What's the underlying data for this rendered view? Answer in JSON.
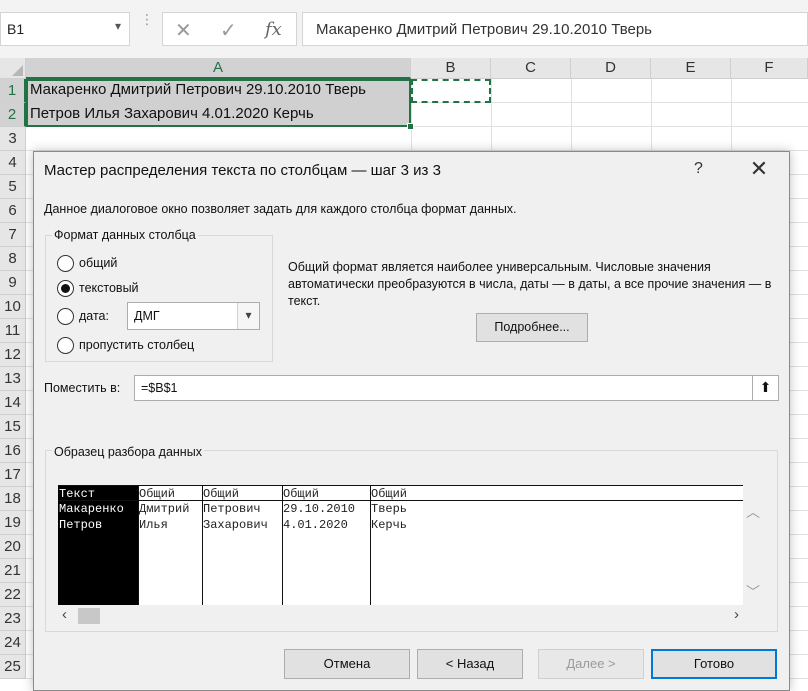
{
  "formula_bar": {
    "name_box": "B1",
    "name_box_arrow": "▾",
    "dots": "⋮",
    "cancel_glyph": "✕",
    "enter_glyph": "✓",
    "fx_glyph": "fx",
    "formula": "Макаренко Дмитрий Петрович 29.10.2010 Тверь"
  },
  "grid": {
    "columns": [
      "A",
      "B",
      "C",
      "D",
      "E",
      "F"
    ],
    "rows": [
      "1",
      "2",
      "3",
      "4",
      "5",
      "6",
      "7",
      "8",
      "9",
      "10",
      "11",
      "12",
      "13",
      "14",
      "15",
      "16",
      "17",
      "18",
      "19",
      "20",
      "21",
      "22",
      "23",
      "24",
      "25"
    ],
    "cells": {
      "A1": "Макаренко Дмитрий Петрович 29.10.2010 Тверь",
      "A2": "Петров Илья Захарович 4.01.2020 Керчь"
    }
  },
  "dialog": {
    "title": "Мастер распределения текста по столбцам — шаг 3 из 3",
    "help": "?",
    "close": "✕",
    "description": "Данное диалоговое окно позволяет задать для каждого столбца формат данных.",
    "format_group": {
      "label": "Формат данных столбца",
      "options": [
        {
          "label": "общий",
          "checked": false
        },
        {
          "label": "текстовый",
          "checked": true
        },
        {
          "label": "дата:",
          "checked": false
        },
        {
          "label": "пропустить столбец",
          "checked": false
        }
      ],
      "date_format": "ДМГ",
      "dropdown_glyph": "▾"
    },
    "info": "Общий формат является наиболее универсальным. Числовые значения автоматически преобразуются в числа, даты — в даты, а все прочие значения — в текст.",
    "details_button": "Подробнее...",
    "destination": {
      "label": "Поместить в:",
      "value": "=$B$1",
      "button_glyph": "⬆"
    },
    "preview": {
      "label": "Образец разбора данных",
      "columns": [
        {
          "header": "Текст",
          "values": [
            "Макаренко",
            "Петров"
          ],
          "selected": true
        },
        {
          "header": "Общий",
          "values": [
            "Дмитрий",
            "Илья"
          ],
          "selected": false
        },
        {
          "header": "Общий",
          "values": [
            "Петрович",
            "Захарович"
          ],
          "selected": false
        },
        {
          "header": "Общий",
          "values": [
            "29.10.2010",
            "4.01.2020"
          ],
          "selected": false
        },
        {
          "header": "Общий",
          "values": [
            "Тверь",
            "Керчь"
          ],
          "selected": false
        }
      ],
      "scroll_up": "︿",
      "scroll_down": "﹀",
      "scroll_left": "‹",
      "scroll_right": "›"
    },
    "buttons": {
      "cancel": "Отмена",
      "back": "< Назад",
      "next": "Далее >",
      "finish": "Готово"
    }
  }
}
